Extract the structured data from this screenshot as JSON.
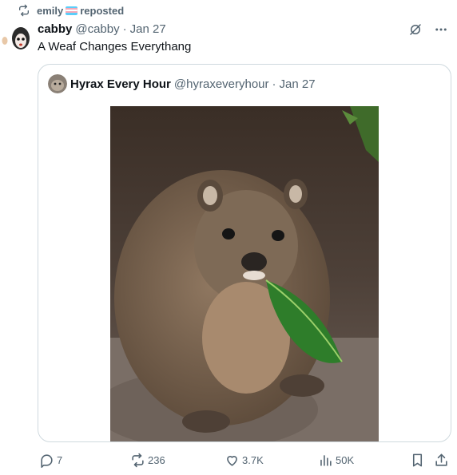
{
  "repost": {
    "user": "emily",
    "label": "reposted",
    "icon": "repost-icon"
  },
  "tweet": {
    "display_name": "cabby",
    "handle": "@cabby",
    "separator": "·",
    "date": "Jan 27",
    "text": "A Weaf Changes Everythang"
  },
  "quote": {
    "display_name": "Hyrax Every Hour",
    "handle": "@hyraxeveryhour",
    "separator": "·",
    "date": "Jan 27",
    "image_alt": "Rock hyrax holding a green leaf in its mouth"
  },
  "actions": {
    "replies": "7",
    "reposts": "236",
    "likes": "3.7K",
    "views": "50K"
  },
  "icons": {
    "grok": "grok-icon",
    "more": "more-icon",
    "reply": "reply-icon",
    "repost": "repost-icon",
    "like": "heart-icon",
    "views": "analytics-icon",
    "bookmark": "bookmark-icon",
    "share": "share-icon"
  },
  "colors": {
    "text_primary": "#0f1419",
    "text_secondary": "#536471",
    "border": "#cfd9de",
    "trans_blue": "#5bcefa",
    "trans_pink": "#f5a9b8",
    "trans_white": "#ffffff"
  }
}
